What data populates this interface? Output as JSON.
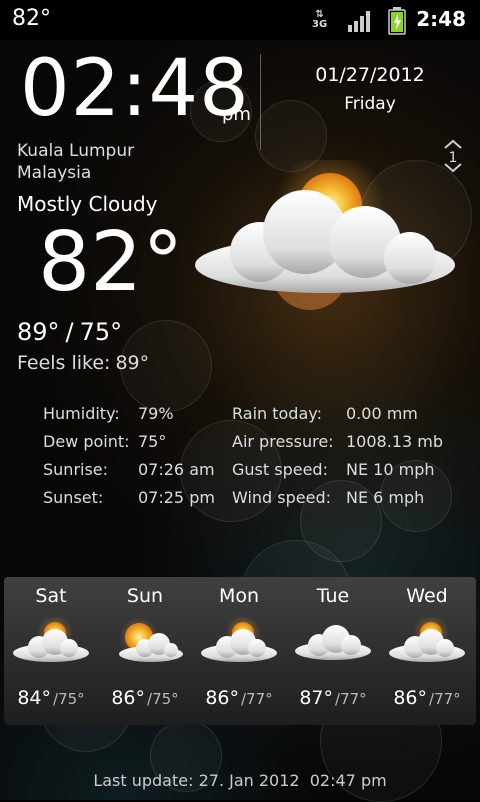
{
  "status_bar": {
    "temperature": "82°",
    "time": "2:48",
    "network": "3G",
    "icons": [
      "signal-icon",
      "battery-icon"
    ]
  },
  "clock": {
    "time": "02:48",
    "ampm": "pm",
    "date": "01/27/2012",
    "weekday": "Friday",
    "page_indicator": "1"
  },
  "location": {
    "city": "Kuala Lumpur",
    "country": "Malaysia"
  },
  "current": {
    "condition": "Mostly Cloudy",
    "temperature": "82°",
    "high": "89°",
    "separator": "/",
    "low": "75°",
    "feels_like_label": "Feels like:",
    "feels_like_value": "89°",
    "icon": "partly-cloudy-icon"
  },
  "details": {
    "humidity": {
      "label": "Humidity:",
      "value": "79%"
    },
    "dew_point": {
      "label": "Dew point:",
      "value": "75°"
    },
    "sunrise": {
      "label": "Sunrise:",
      "value": "07:26 am"
    },
    "sunset": {
      "label": "Sunset:",
      "value": "07:25 pm"
    },
    "rain_today": {
      "label": "Rain today:",
      "value": "0.00 mm"
    },
    "air_pressure": {
      "label": "Air pressure:",
      "value": "1008.13 mb"
    },
    "gust_speed": {
      "label": "Gust speed:",
      "value": "NE 10 mph"
    },
    "wind_speed": {
      "label": "Wind speed:",
      "value": "NE 6 mph"
    }
  },
  "forecast": [
    {
      "day": "Sat",
      "high": "84°",
      "low": "/75°",
      "icon": "partly-cloudy-icon"
    },
    {
      "day": "Sun",
      "high": "86°",
      "low": "/75°",
      "icon": "partly-sunny-icon"
    },
    {
      "day": "Mon",
      "high": "86°",
      "low": "/77°",
      "icon": "partly-cloudy-icon"
    },
    {
      "day": "Tue",
      "high": "87°",
      "low": "/77°",
      "icon": "cloudy-icon"
    },
    {
      "day": "Wed",
      "high": "86°",
      "low": "/77°",
      "icon": "partly-cloudy-icon"
    }
  ],
  "last_update": "Last update: 27. Jan 2012  02:47 pm",
  "colors": {
    "sun": "#f5b22a",
    "cloud": "#f2f2f2",
    "forecast_bar": "#404040",
    "battery": "#8bd12e"
  }
}
